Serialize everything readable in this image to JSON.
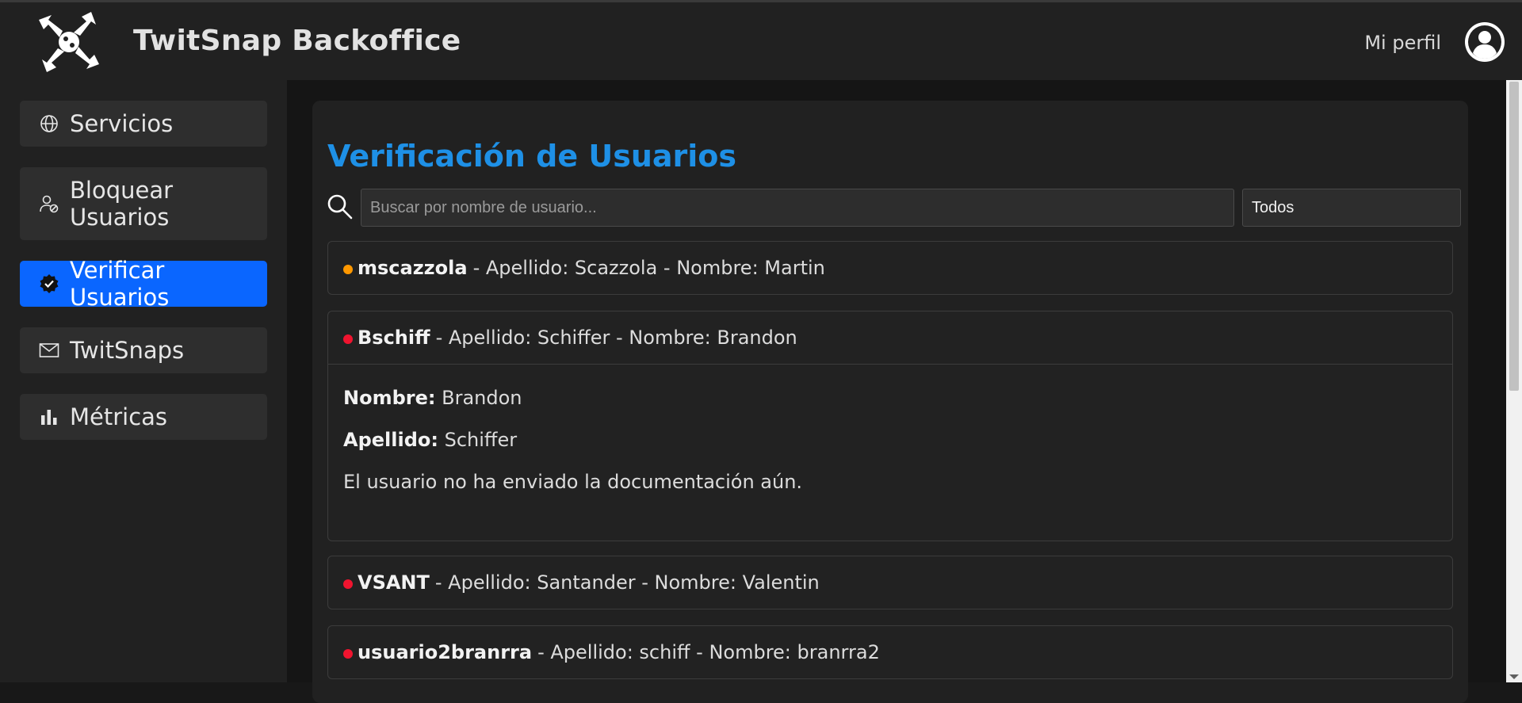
{
  "app": {
    "title": "TwitSnap Backoffice",
    "profile_label": "Mi perfil"
  },
  "sidebar": {
    "items": [
      {
        "label": "Servicios",
        "icon": "globe-icon",
        "active": false
      },
      {
        "label": "Bloquear Usuarios",
        "icon": "user-block-icon",
        "active": false
      },
      {
        "label": "Verificar Usuarios",
        "icon": "verified-badge-icon",
        "active": true
      },
      {
        "label": "TwitSnaps",
        "icon": "envelope-icon",
        "active": false
      },
      {
        "label": "Métricas",
        "icon": "bar-chart-icon",
        "active": false
      }
    ]
  },
  "main": {
    "title": "Verificación de Usuarios",
    "search": {
      "placeholder": "Buscar por nombre de usuario...",
      "value": ""
    },
    "filter": {
      "selected": "Todos"
    },
    "users": [
      {
        "username": "mscazzola",
        "summary": "- Apellido: Scazzola - Nombre: Martin",
        "status_color": "#ff9800"
      },
      {
        "username": "Bschiff",
        "summary": "- Apellido: Schiffer - Nombre: Brandon",
        "status_color": "#f0142f",
        "expanded": true,
        "details": {
          "nombre_label": "Nombre:",
          "nombre": "Brandon",
          "apellido_label": "Apellido:",
          "apellido": "Schiffer",
          "message": "El usuario no ha enviado la documentación aún."
        }
      },
      {
        "username": "VSANT",
        "summary": "- Apellido: Santander - Nombre: Valentin",
        "status_color": "#f0142f"
      },
      {
        "username": "usuario2branrra",
        "summary": "- Apellido: schiff - Nombre: branrra2",
        "status_color": "#f0142f"
      }
    ]
  },
  "colors": {
    "accent": "#0a66ff",
    "title_blue": "#1e90e6",
    "status_pending": "#ff9800",
    "status_unverified": "#f0142f"
  }
}
